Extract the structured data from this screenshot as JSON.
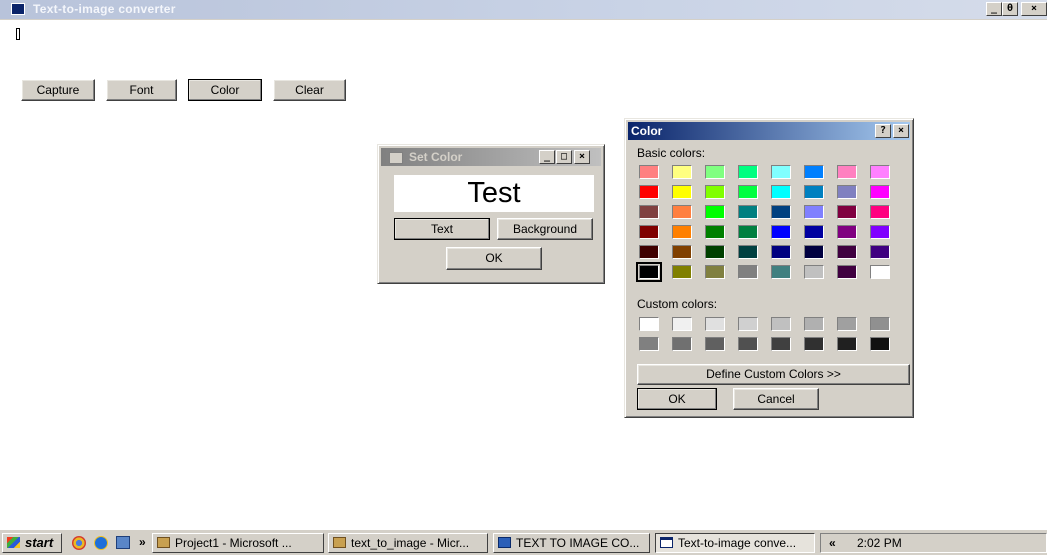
{
  "main_window": {
    "title": "Text-to-image converter",
    "controls": [
      "_",
      "θ",
      "×"
    ],
    "buttons": {
      "capture": "Capture",
      "font": "Font",
      "color": "Color",
      "clear": "Clear"
    }
  },
  "set_color_dialog": {
    "title": "Set Color",
    "controls": [
      "_",
      "□",
      "×"
    ],
    "preview_text": "Test",
    "buttons": {
      "text": "Text",
      "background": "Background",
      "ok": "OK"
    }
  },
  "color_dialog": {
    "title": "Color",
    "controls": [
      "?",
      "×"
    ],
    "basic_colors_label": "Basic colors:",
    "custom_colors_label": "Custom colors:",
    "define_custom_label": "Define Custom Colors >>",
    "ok_label": "OK",
    "cancel_label": "Cancel",
    "selected_basic_index": 40,
    "basic_colors": [
      "#ff8080",
      "#ffff80",
      "#80ff80",
      "#00ff80",
      "#80ffff",
      "#0080ff",
      "#ff80c0",
      "#ff80ff",
      "#ff0000",
      "#ffff00",
      "#80ff00",
      "#00ff40",
      "#00ffff",
      "#0080c0",
      "#8080c0",
      "#ff00ff",
      "#804040",
      "#ff8040",
      "#00ff00",
      "#008080",
      "#004080",
      "#8080ff",
      "#800040",
      "#ff0080",
      "#800000",
      "#ff8000",
      "#008000",
      "#008040",
      "#0000ff",
      "#0000a0",
      "#800080",
      "#8000ff",
      "#400000",
      "#804000",
      "#004000",
      "#004040",
      "#000080",
      "#000040",
      "#400040",
      "#400080",
      "#000000",
      "#808000",
      "#808040",
      "#808080",
      "#408080",
      "#c0c0c0",
      "#400040",
      "#ffffff"
    ],
    "custom_colors": [
      "#ffffff",
      "#f0f0f0",
      "#e0e0e0",
      "#d0d0d0",
      "#c0c0c0",
      "#b0b0b0",
      "#a0a0a0",
      "#909090",
      "#808080",
      "#707070",
      "#606060",
      "#505050",
      "#404040",
      "#303030",
      "#202020",
      "#101010"
    ]
  },
  "taskbar": {
    "start_label": "start",
    "more_label": "»",
    "tasks": [
      "Project1 - Microsoft ...",
      "text_to_image - Micr...",
      "TEXT TO IMAGE CO...",
      "Text-to-image conve..."
    ],
    "tray_arrow": "«",
    "clock": "2:02 PM"
  }
}
